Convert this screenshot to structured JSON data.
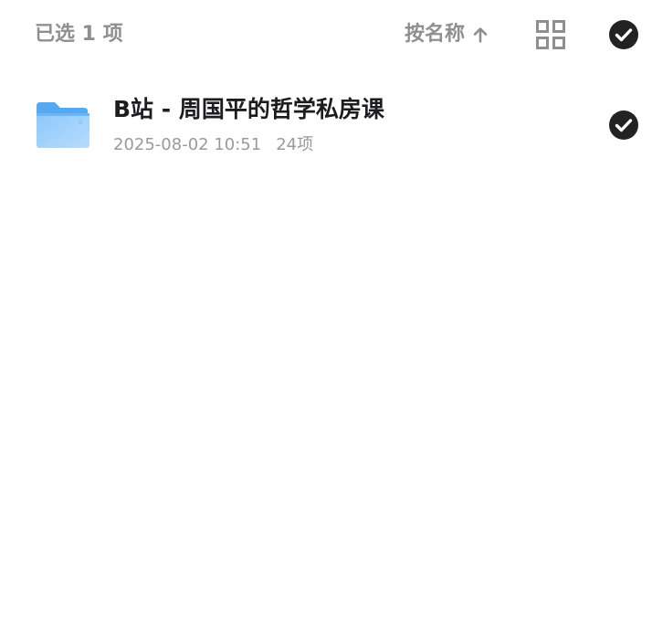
{
  "header": {
    "selected_label": "已选 1 项",
    "sort_label": "按名称",
    "sort_icon": "arrow-up-icon",
    "view_icon": "grid-view-icon",
    "select_all_icon": "check-circle-icon",
    "select_all_checked": true
  },
  "items": [
    {
      "name": "B站 - 周国平的哲学私房课",
      "date": "2025-08-02 10:51",
      "count": "24项",
      "icon": "folder-icon",
      "selected": true
    }
  ],
  "colors": {
    "muted_text": "#8f8f8f",
    "primary_text": "#1d1d1f",
    "check_fill": "#222222",
    "folder_blue": "#6cb6f5",
    "folder_light": "#a9d5fb"
  }
}
